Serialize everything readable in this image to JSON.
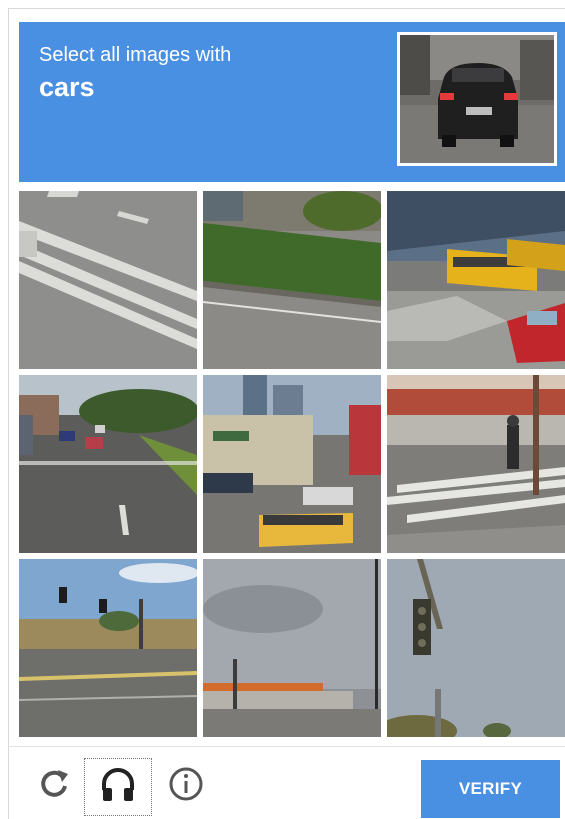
{
  "header": {
    "prompt": "Select all images with",
    "target": "cars",
    "bg_color": "#4a90e2"
  },
  "grid": {
    "rows": 3,
    "cols": 3,
    "tiles": [
      {
        "scene": "road-lane-markings"
      },
      {
        "scene": "hedge-and-road"
      },
      {
        "scene": "school-buses-and-red-truck"
      },
      {
        "scene": "street-with-cars"
      },
      {
        "scene": "intersection-with-taxi"
      },
      {
        "scene": "crosswalk-with-pedestrian"
      },
      {
        "scene": "intersection-with-traffic-light"
      },
      {
        "scene": "gas-station-under-sky"
      },
      {
        "scene": "hanging-traffic-light"
      }
    ]
  },
  "footer": {
    "reload_icon": "reload-icon",
    "audio_icon": "headphones-icon",
    "info_icon": "info-icon",
    "verify_label": "VERIFY",
    "accent": "#4a90e2"
  }
}
